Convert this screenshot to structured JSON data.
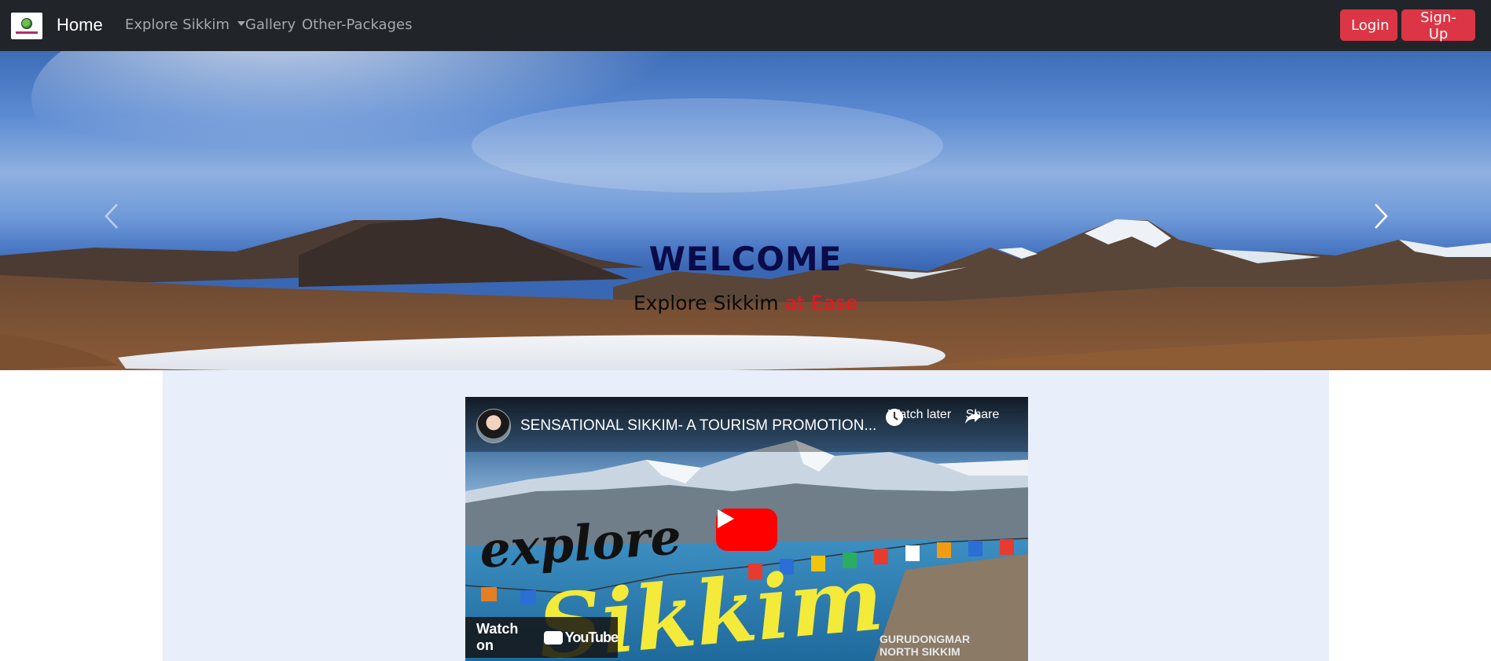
{
  "navbar": {
    "home_label": "Home",
    "links": {
      "explore": "Explore Sikkim",
      "gallery": "Gallery",
      "packages": "Other-Packages"
    },
    "login_label": "Login",
    "signup_label": "Sign-Up",
    "logo_icon": "sikkim-tourism-logo"
  },
  "hero": {
    "title": "WELCOME",
    "subtitle_main": "Explore Sikkim",
    "subtitle_accent": "at Ease",
    "prev_icon": "chevron-left-icon",
    "next_icon": "chevron-right-icon"
  },
  "video": {
    "title": "SENSATIONAL SIKKIM- A TOURISM PROMOTION...",
    "watch_later": "Watch later",
    "share": "Share",
    "watch_on": "Watch on",
    "youtube": "YouTube",
    "thumb_text_1": "explore",
    "thumb_text_2": "Sikkim",
    "location_line1": "GURUDONGMAR",
    "location_line2": "NORTH SIKKIM"
  },
  "colors": {
    "navbar_bg": "#212529",
    "button_red": "#dc3545",
    "title_navy": "#0b0b4a",
    "accent_red": "#ff0d1f",
    "content_bg": "#e8effb"
  }
}
